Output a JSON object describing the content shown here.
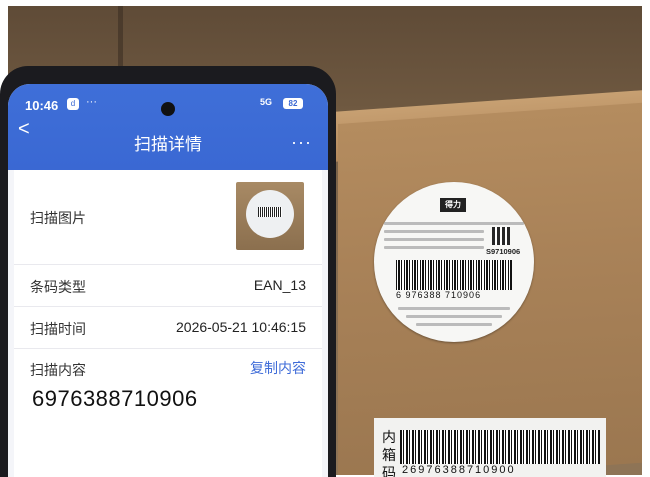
{
  "status": {
    "time": "10:46",
    "app_badge": "d",
    "more": "···",
    "signal": "5G",
    "battery": "82"
  },
  "header": {
    "back": "<",
    "title": "扫描详情",
    "more": "···"
  },
  "scan": {
    "image_label": "扫描图片",
    "type_label": "条码类型",
    "type_value": "EAN_13",
    "time_label": "扫描时间",
    "time_value": "2026-05-21 10:46:15",
    "content_label": "扫描内容",
    "copy_label": "复制内容",
    "content_value": "6976388710906"
  },
  "sticker": {
    "brand": "得力",
    "code": "S9710906",
    "barcode": "6 976388 710906"
  },
  "box_label": {
    "text": "内箱码",
    "barcode": "26976388710900"
  }
}
